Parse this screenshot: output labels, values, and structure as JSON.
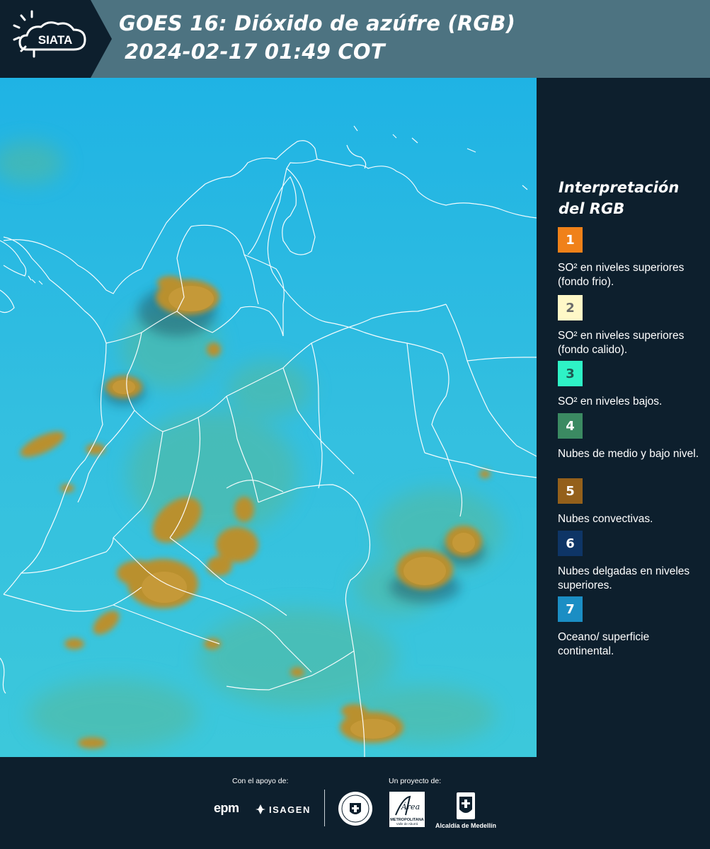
{
  "header": {
    "logo_text": "SIATA",
    "title_line_1": "GOES 16: Dióxido de azúfre (RGB)",
    "title_line_2": "2024-02-17 01:49 COT",
    "background_color": "#4d7381",
    "logo_background_color": "#0d1f2d"
  },
  "map": {
    "description_icon": "satellite-rgb-image",
    "ocean_color": "#29b6de",
    "boundary_color": "#ffffff"
  },
  "legend": {
    "title": "Interpretación del RGB",
    "items": [
      {
        "number": "1",
        "label": "SO² en niveles superiores (fondo frio).",
        "color": "#f08119",
        "number_color": "#ffffff"
      },
      {
        "number": "2",
        "label": "SO² en niveles superiores (fondo calido).",
        "color": "#fff8c7",
        "number_color": "#6b6b6b"
      },
      {
        "number": "3",
        "label": "SO² en niveles bajos.",
        "color": "#2ef2c6",
        "number_color": "#1d5a52"
      },
      {
        "number": "4",
        "label": "Nubes de medio y bajo nivel.",
        "color": "#3b8a62",
        "number_color": "#ffffff"
      },
      {
        "number": "5",
        "label": "Nubes convectivas.",
        "color": "#94601b",
        "number_color": "#ffffff"
      },
      {
        "number": "6",
        "label": "Nubes delgadas en niveles superiores.",
        "color": "#0e3566",
        "number_color": "#ffffff"
      },
      {
        "number": "7",
        "label": "Oceano/ superficie continental.",
        "color": "#1b8ec4",
        "number_color": "#ffffff"
      }
    ]
  },
  "footer": {
    "support_caption": "Con el apoyo de:",
    "project_caption": "Un proyecto de:",
    "epm_label": "epm",
    "isagen_label": "ISAGEN",
    "area_label": "Área",
    "area_sub_label": "METROPOLITANA",
    "area_sub_label_2": "Valle de Aburrá",
    "alcaldia_label": "Alcaldía de Medellín"
  }
}
